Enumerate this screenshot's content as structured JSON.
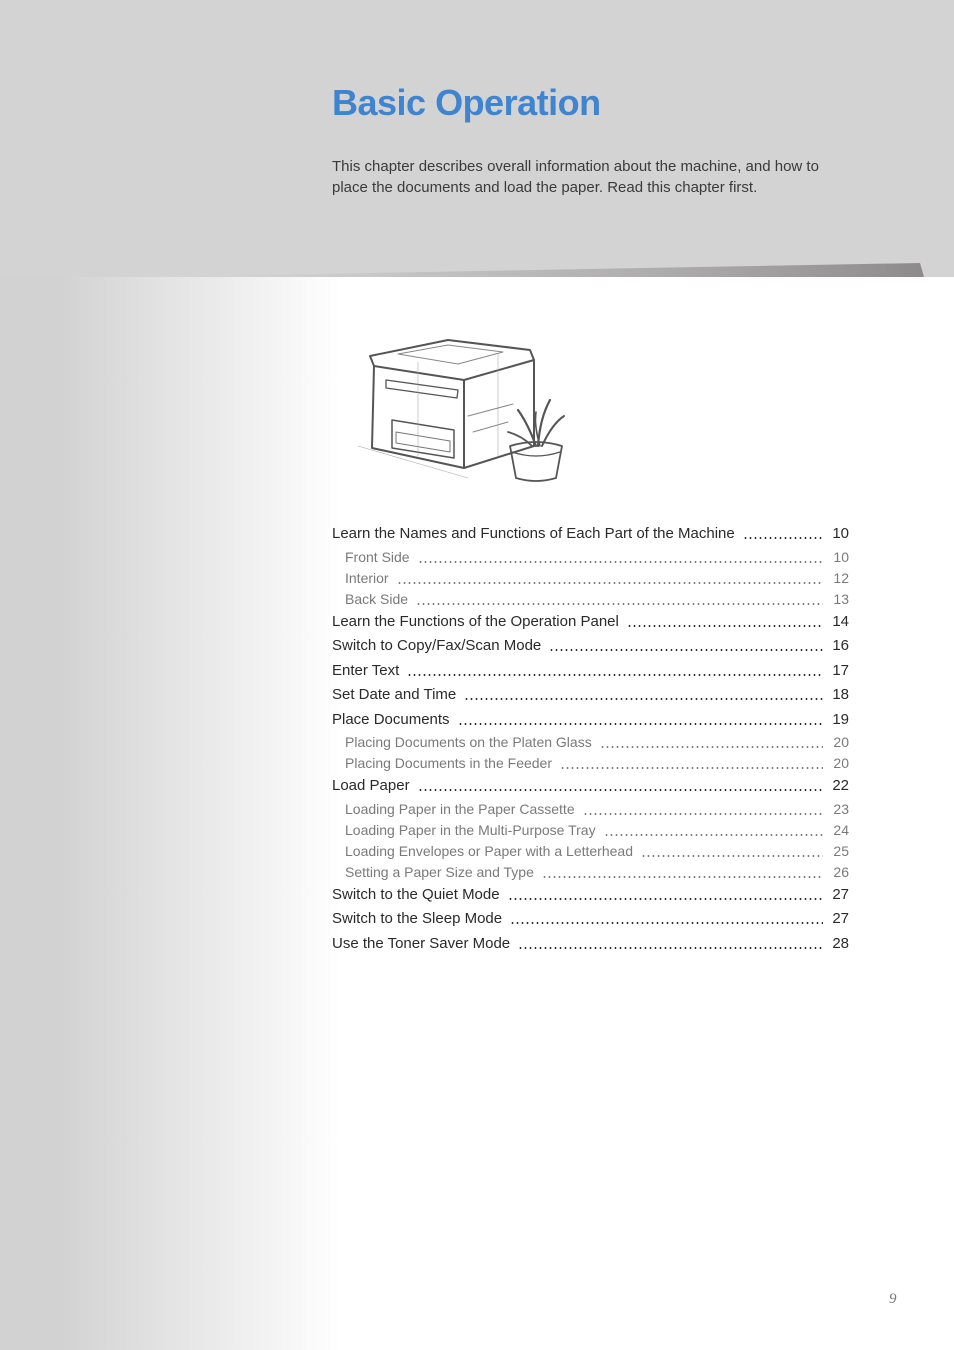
{
  "chapter": {
    "title": "Basic Operation",
    "intro": "This chapter describes overall information about the machine, and how to place the documents and load the paper. Read this chapter first.",
    "colors": {
      "title": "#3e84d1",
      "header_band": "#d3d3d3"
    }
  },
  "illustration": {
    "subject": "printer-with-potted-plant-sketch"
  },
  "toc": [
    {
      "level": "main",
      "label": "Learn the Names and Functions of Each Part of the Machine",
      "page": "10"
    },
    {
      "level": "sub",
      "label": "Front Side",
      "page": "10"
    },
    {
      "level": "sub",
      "label": "Interior",
      "page": "12"
    },
    {
      "level": "sub",
      "label": "Back Side",
      "page": "13"
    },
    {
      "level": "main",
      "label": "Learn the Functions of the Operation Panel",
      "page": "14"
    },
    {
      "level": "main",
      "label": "Switch to Copy/Fax/Scan Mode",
      "page": "16"
    },
    {
      "level": "main",
      "label": "Enter Text",
      "page": "17"
    },
    {
      "level": "main",
      "label": "Set Date and Time",
      "page": "18"
    },
    {
      "level": "main",
      "label": "Place Documents",
      "page": "19"
    },
    {
      "level": "sub",
      "label": "Placing Documents on the Platen Glass",
      "page": "20"
    },
    {
      "level": "sub",
      "label": "Placing Documents in the Feeder",
      "page": "20"
    },
    {
      "level": "main",
      "label": "Load Paper",
      "page": "22"
    },
    {
      "level": "sub",
      "label": "Loading Paper in the Paper Cassette",
      "page": "23"
    },
    {
      "level": "sub",
      "label": "Loading Paper in the Multi-Purpose Tray",
      "page": "24"
    },
    {
      "level": "sub",
      "label": "Loading Envelopes or Paper with a Letterhead",
      "page": "25"
    },
    {
      "level": "sub",
      "label": "Setting a Paper Size and Type",
      "page": "26"
    },
    {
      "level": "main",
      "label": "Switch to the Quiet Mode",
      "page": "27"
    },
    {
      "level": "main",
      "label": "Switch to the Sleep Mode",
      "page": "27"
    },
    {
      "level": "main",
      "label": "Use the Toner Saver Mode",
      "page": "28"
    }
  ],
  "footer": {
    "page_number": "9"
  }
}
